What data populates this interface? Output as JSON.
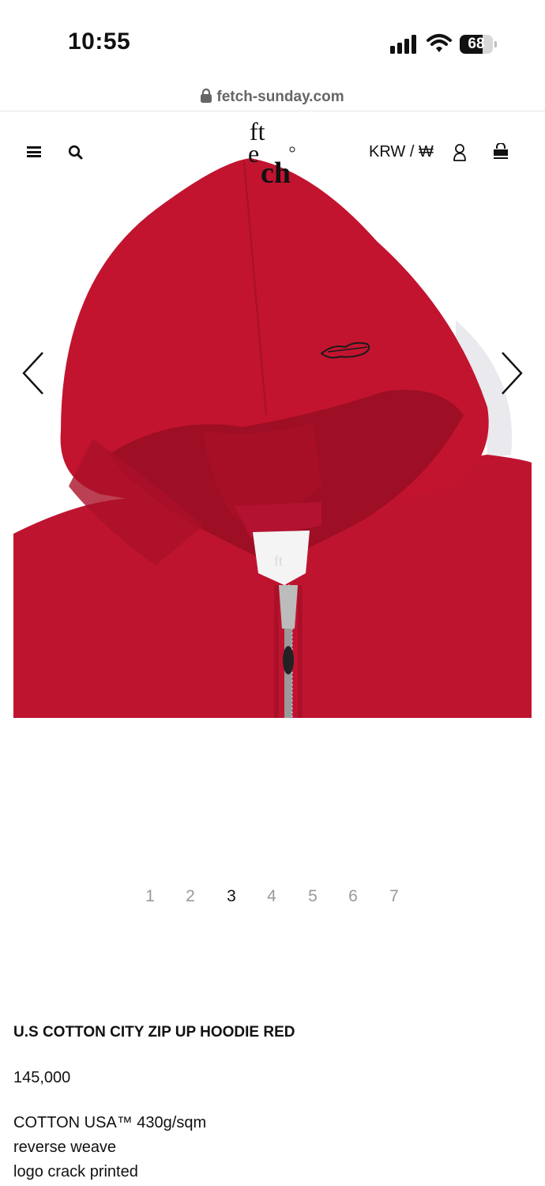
{
  "status_bar": {
    "time": "10:55",
    "battery_level": "68",
    "icons": [
      "signal-icon",
      "wifi-icon",
      "battery-icon"
    ]
  },
  "browser": {
    "url": "fetch-sunday.com",
    "secure_icon": "lock-icon"
  },
  "header": {
    "logo_text": "fetch",
    "currency": "KRW / ₩",
    "icons": [
      "menu-icon",
      "search-icon",
      "user-icon",
      "cart-icon"
    ]
  },
  "gallery": {
    "image_subject": "red zip up hoodie",
    "prev_icon": "chevron-left-icon",
    "next_icon": "chevron-right-icon",
    "pages": [
      "1",
      "2",
      "3",
      "4",
      "5",
      "6",
      "7"
    ],
    "active_page": 3
  },
  "product": {
    "title": "U.S COTTON CITY ZIP UP HOODIE RED",
    "price": "145,000",
    "description": [
      "COTTON USA™ 430g/sqm",
      "reverse weave",
      "logo crack printed"
    ]
  },
  "colors": {
    "hoodie_red": "#c0122c",
    "text": "#111111",
    "inactive_page": "#999999"
  }
}
